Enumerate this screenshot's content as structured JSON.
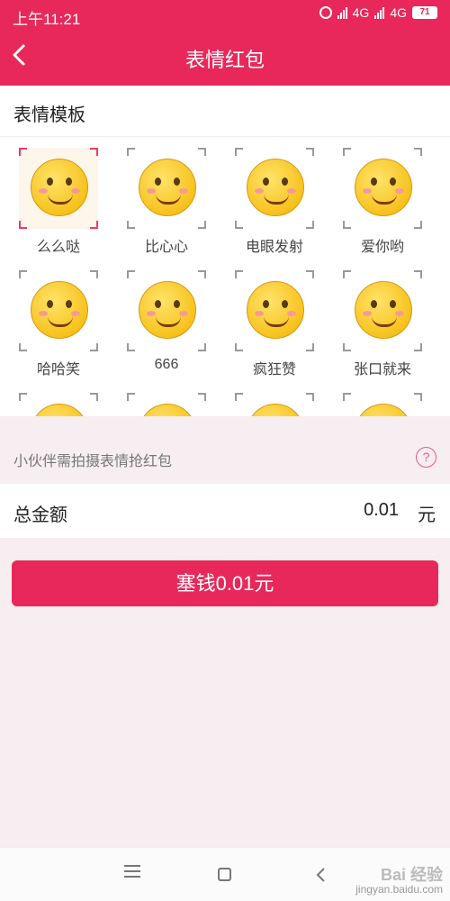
{
  "status_bar": {
    "time": "上午11:21",
    "network_1": "4G",
    "network_2": "4G",
    "battery": "71"
  },
  "header": {
    "title": "表情红包"
  },
  "templates": {
    "title": "表情模板",
    "items": [
      {
        "label": "么么哒",
        "selected": true
      },
      {
        "label": "比心心",
        "selected": false
      },
      {
        "label": "电眼发射",
        "selected": false
      },
      {
        "label": "爱你哟",
        "selected": false
      },
      {
        "label": "哈哈笑",
        "selected": false
      },
      {
        "label": "666",
        "selected": false
      },
      {
        "label": "疯狂赞",
        "selected": false
      },
      {
        "label": "张口就来",
        "selected": false
      }
    ]
  },
  "hint": {
    "text": "小伙伴需拍摄表情抢红包",
    "help_glyph": "?"
  },
  "amount": {
    "label": "总金额",
    "value": "0.01",
    "unit": "元"
  },
  "submit": {
    "label": "塞钱0.01元"
  },
  "watermark": {
    "logo": "Bai 经验",
    "url": "jingyan.baidu.com"
  },
  "colors": {
    "brand": "#e8285a",
    "background": "#f6eef1",
    "selected_frame": "#fdf6ea"
  }
}
